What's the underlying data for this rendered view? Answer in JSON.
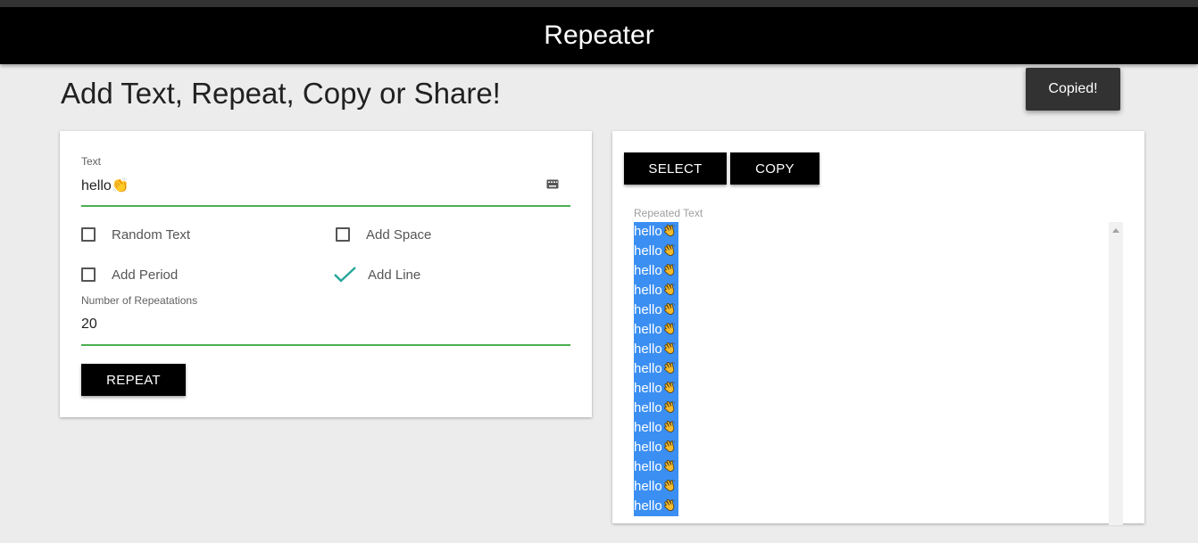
{
  "app": {
    "title": "Repeater"
  },
  "page": {
    "heading": "Add Text, Repeat, Copy or Share!"
  },
  "toast": {
    "message": "Copied!"
  },
  "form": {
    "text_label": "Text",
    "text_value": "hello👏",
    "options": {
      "random_text": {
        "label": "Random Text",
        "checked": false
      },
      "add_space": {
        "label": "Add Space",
        "checked": false
      },
      "add_period": {
        "label": "Add Period",
        "checked": false
      },
      "add_line": {
        "label": "Add Line",
        "checked": true
      }
    },
    "repetitions_label": "Number of Repeatations",
    "repetitions_value": "20",
    "repeat_button": "REPEAT"
  },
  "output": {
    "select_button": "SELECT",
    "copy_button": "COPY",
    "label": "Repeated Text",
    "line_text": "hello",
    "line_icon": "clapping-hands-icon",
    "visible_lines": 15
  },
  "colors": {
    "accent_underline": "#4caf50",
    "checkmark": "#26a69a",
    "selection_highlight": "#3b8ff2",
    "toast_bg": "#323232"
  }
}
